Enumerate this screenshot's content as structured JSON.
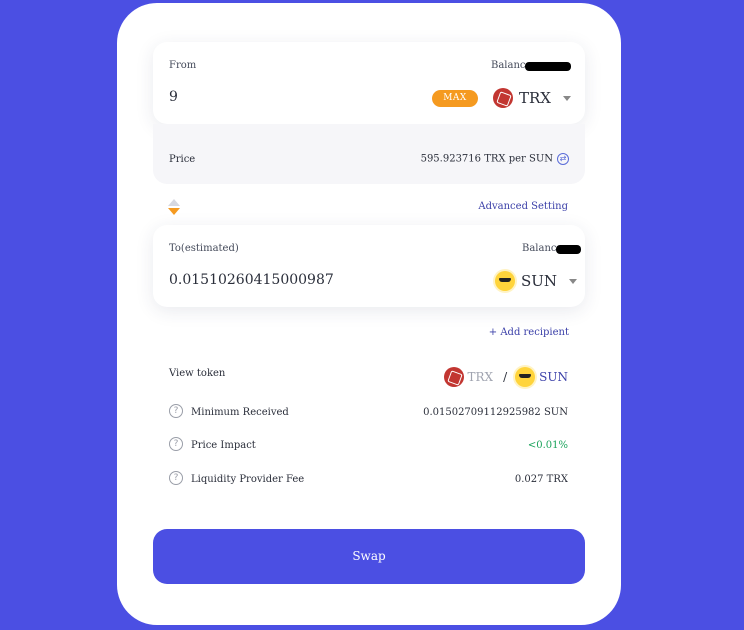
{
  "from": {
    "label": "From",
    "balance_label": "Balance",
    "amount": "9",
    "max_label": "MAX",
    "token": "TRX",
    "token_icon": "trx-logo-icon"
  },
  "price": {
    "label": "Price",
    "value": "595.923716 TRX per SUN",
    "swap_icon": "exchange-icon"
  },
  "advanced_setting": "Advanced Setting",
  "to": {
    "label": "To(estimated)",
    "balance_label": "Balance",
    "amount": "0.01510260415000987",
    "token": "SUN",
    "token_icon": "sun-logo-icon"
  },
  "add_recipient": "+ Add recipient",
  "view_token": {
    "label": "View token",
    "token_a": "TRX",
    "separator": "/",
    "token_b": "SUN"
  },
  "details": [
    {
      "label": "Minimum Received",
      "value": "0.01502709112925982 SUN"
    },
    {
      "label": "Price Impact",
      "value": "<0.01%"
    },
    {
      "label": "Liquidity Provider Fee",
      "value": "0.027 TRX"
    }
  ],
  "swap_button": "Swap",
  "colors": {
    "background": "#4b4fe3",
    "accent_orange": "#f59a20",
    "positive_green": "#1aa35b",
    "link_blue": "#3a3fa8"
  }
}
